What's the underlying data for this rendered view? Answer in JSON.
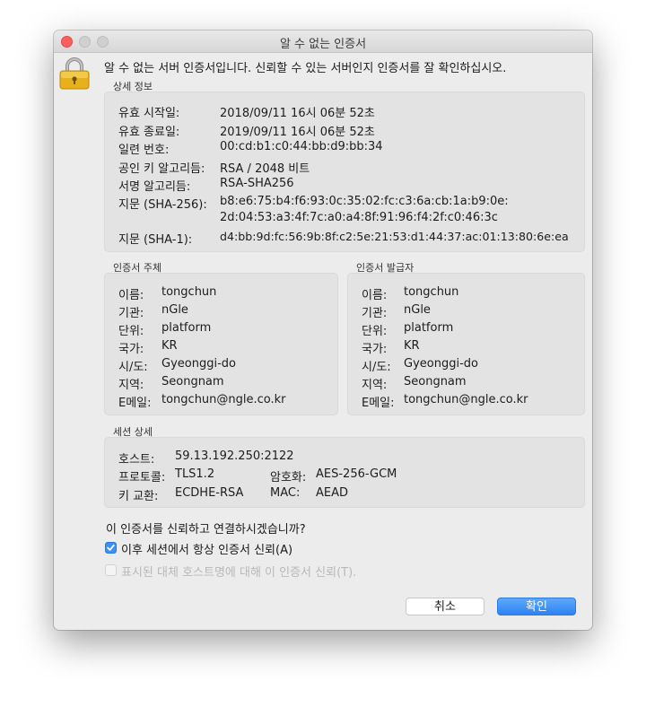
{
  "window": {
    "title": "알 수 없는 인증서"
  },
  "headline": "알 수 없는 서버 인증서입니다. 신뢰할 수 있는 서버인지 인증서를 잘 확인하십시오.",
  "details": {
    "label": "상세 정보",
    "rows": [
      {
        "key": "유효 시작일:",
        "value": "2018/09/11 16시 06분 52초"
      },
      {
        "key": "유효 종료일:",
        "value": "2019/09/11 16시 06분 52초"
      },
      {
        "key": "일련 번호:",
        "value": "00:cd:b1:c0:44:bb:d9:bb:34"
      },
      {
        "key": "공인 키 알고리듬:",
        "value": "RSA / 2048 비트"
      },
      {
        "key": "서명 알고리듬:",
        "value": "RSA-SHA256"
      },
      {
        "key": "지문 (SHA-256):",
        "value": "b8:e6:75:b4:f6:93:0c:35:02:fc:c3:6a:cb:1a:b9:0e:",
        "value2": "2d:04:53:a3:4f:7c:a0:a4:8f:91:96:f4:2f:c0:46:3c"
      },
      {
        "key": "지문 (SHA-1):",
        "value": "d4:bb:9d:fc:56:9b:8f:c2:5e:21:53:d1:44:37:ac:01:13:80:6e:ea"
      }
    ]
  },
  "subject": {
    "label": "인증서 주체",
    "rows": [
      {
        "key": "이름:",
        "value": "tongchun"
      },
      {
        "key": "기관:",
        "value": "nGle"
      },
      {
        "key": "단위:",
        "value": "platform"
      },
      {
        "key": "국가:",
        "value": "KR"
      },
      {
        "key": "시/도:",
        "value": "Gyeonggi-do"
      },
      {
        "key": "지역:",
        "value": "Seongnam"
      },
      {
        "key": "E메일:",
        "value": "tongchun@ngle.co.kr"
      }
    ]
  },
  "issuer": {
    "label": "인증서 발급자",
    "rows": [
      {
        "key": "이름:",
        "value": "tongchun"
      },
      {
        "key": "기관:",
        "value": "nGle"
      },
      {
        "key": "단위:",
        "value": "platform"
      },
      {
        "key": "국가:",
        "value": "KR"
      },
      {
        "key": "시/도:",
        "value": "Gyeonggi-do"
      },
      {
        "key": "지역:",
        "value": "Seongnam"
      },
      {
        "key": "E메일:",
        "value": "tongchun@ngle.co.kr"
      }
    ]
  },
  "session": {
    "label": "세션 상세",
    "host_key": "호스트:",
    "host_value": "59.13.192.250:2122",
    "protocol_key": "프로토콜:",
    "protocol_value": "TLS1.2",
    "cipher_key": "암호화:",
    "cipher_value": "AES-256-GCM",
    "kex_key": "키 교환:",
    "kex_value": "ECDHE-RSA",
    "mac_key": "MAC:",
    "mac_value": "AEAD"
  },
  "question": "이 인증서를 신뢰하고 연결하시겠습니까?",
  "options": {
    "always_trust": {
      "label": "이후 세션에서 항상 인증서 신뢰(A)",
      "checked": true
    },
    "alt_host": {
      "label": "표시된 대체 호스트명에 대해 이 인증서 신뢰(T).",
      "checked": false
    }
  },
  "buttons": {
    "cancel": "취소",
    "ok": "확인"
  },
  "colors": {
    "accent": "#2e83f2",
    "close": "#fc605c",
    "lock": "#e8b11c"
  }
}
